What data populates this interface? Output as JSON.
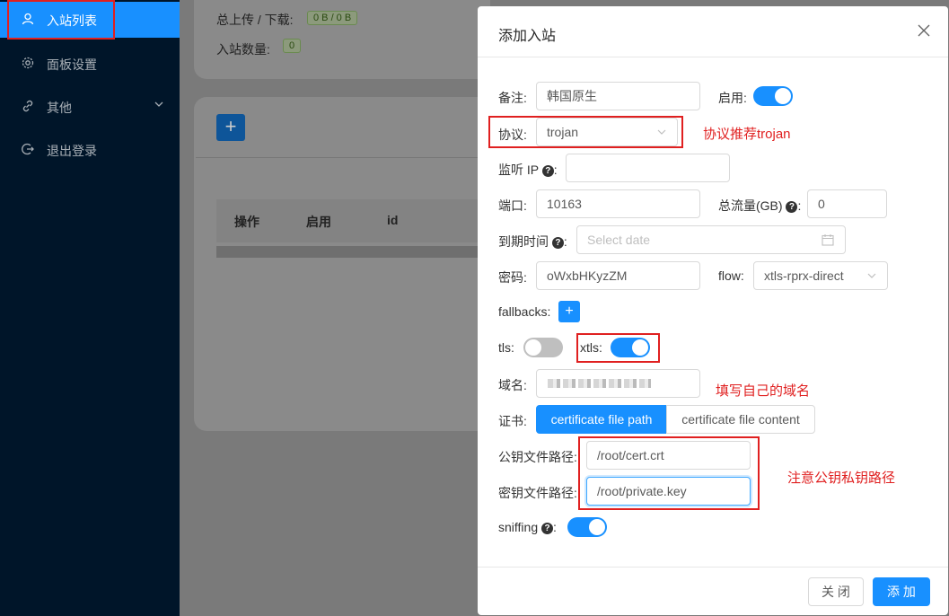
{
  "sidebar": {
    "items": [
      {
        "label": "入站列表",
        "icon": "user-icon"
      },
      {
        "label": "面板设置",
        "icon": "gear-icon"
      },
      {
        "label": "其他",
        "icon": "link-icon"
      },
      {
        "label": "退出登录",
        "icon": "logout-icon"
      }
    ]
  },
  "background": {
    "stats": {
      "upload_label": "总上传 / 下载:",
      "upload_value": "0 B / 0 B",
      "count_label": "入站数量:",
      "count_value": "0"
    },
    "add_button": "+",
    "table_headers": [
      "操作",
      "启用",
      "id"
    ]
  },
  "modal": {
    "title": "添加入站",
    "fields": {
      "remark_label": "备注:",
      "remark_value": "韩国原生",
      "enable_label": "启用:",
      "protocol_label": "协议:",
      "protocol_value": "trojan",
      "listen_label": "监听 IP",
      "listen_value": "",
      "port_label": "端口:",
      "port_value": "10163",
      "total_label": "总流量(GB)",
      "total_value": "0",
      "expire_label": "到期时间",
      "expire_placeholder": "Select date",
      "password_label": "密码:",
      "password_value": "oWxbHKyzZM",
      "flow_label": "flow:",
      "flow_value": "xtls-rprx-direct",
      "fallbacks_label": "fallbacks:",
      "fallbacks_add": "+",
      "tls_label": "tls:",
      "xtls_label": "xtls:",
      "domain_label": "域名:",
      "cert_label": "证书:",
      "cert_tab_path": "certificate file path",
      "cert_tab_content": "certificate file content",
      "pubkey_label": "公钥文件路径:",
      "pubkey_value": "/root/cert.crt",
      "privkey_label": "密钥文件路径:",
      "privkey_value": "/root/private.key",
      "sniffing_label": "sniffing"
    },
    "buttons": {
      "close": "关 闭",
      "add": "添 加"
    }
  },
  "annotations": {
    "protocol_note": "协议推荐trojan",
    "domain_note": "填写自己的域名",
    "key_note": "注意公钥私钥路径"
  },
  "colors": {
    "primary": "#1890ff",
    "sidebar": "#001529",
    "annotation": "#e02020"
  }
}
